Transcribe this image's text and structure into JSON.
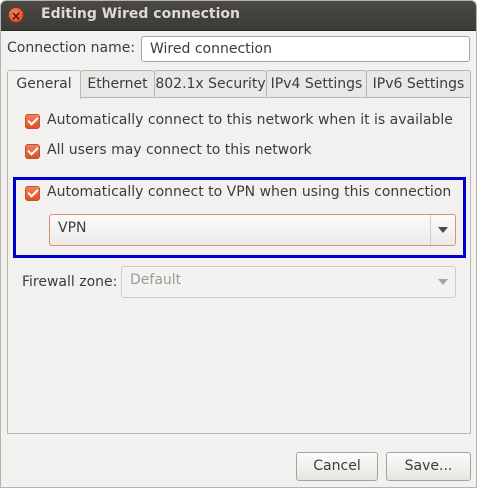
{
  "window": {
    "title": "Editing Wired connection",
    "close_symbol": "×"
  },
  "connection": {
    "label": "Connection name:",
    "value": "Wired connection"
  },
  "tabs": [
    {
      "label": "General",
      "active": true
    },
    {
      "label": "Ethernet",
      "active": false
    },
    {
      "label": "802.1x Security",
      "active": false
    },
    {
      "label": "IPv4 Settings",
      "active": false
    },
    {
      "label": "IPv6 Settings",
      "active": false
    }
  ],
  "general": {
    "auto_connect": {
      "label": "Automatically connect to this network when it is available",
      "checked": true
    },
    "all_users": {
      "label": "All users may connect to this network",
      "checked": true
    },
    "auto_vpn": {
      "label": "Automatically connect to VPN when using this connection",
      "checked": true
    },
    "vpn_select": {
      "value": "VPN"
    },
    "firewall": {
      "label": "Firewall zone:",
      "value": "Default",
      "disabled": true
    }
  },
  "buttons": {
    "cancel": "Cancel",
    "save": "Save..."
  },
  "colors": {
    "highlight": "#0000cc",
    "checkbox_accent": "#dd4f24",
    "titlebar": "#3c3b37"
  }
}
